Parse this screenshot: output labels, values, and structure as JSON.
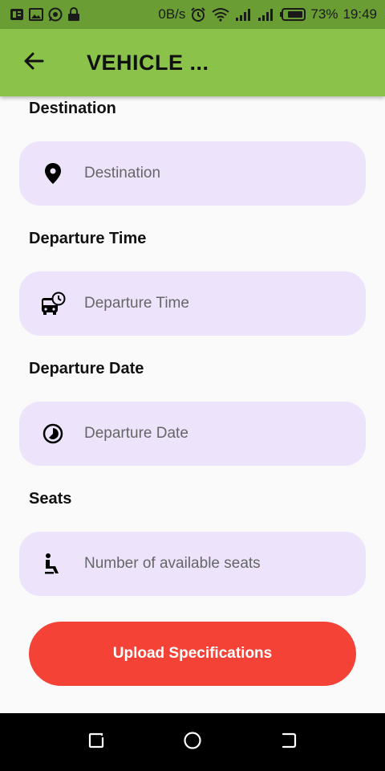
{
  "status_bar": {
    "net_speed": "0B/s",
    "battery": "73%",
    "time": "19:49"
  },
  "app_bar": {
    "title": "VEHICLE ..."
  },
  "form": {
    "destination": {
      "label": "Destination",
      "placeholder": "Destination"
    },
    "departure_time": {
      "label": "Departure Time",
      "placeholder": "Departure Time"
    },
    "departure_date": {
      "label": "Departure Date",
      "placeholder": "Departure Date"
    },
    "seats": {
      "label": "Seats",
      "placeholder": "Number of available seats"
    }
  },
  "actions": {
    "upload_label": "Upload Specifications"
  },
  "colors": {
    "app_bar": "#8bc34a",
    "status_bar": "#6a9e35",
    "field_bg": "#ede4fc",
    "button": "#f44336"
  }
}
